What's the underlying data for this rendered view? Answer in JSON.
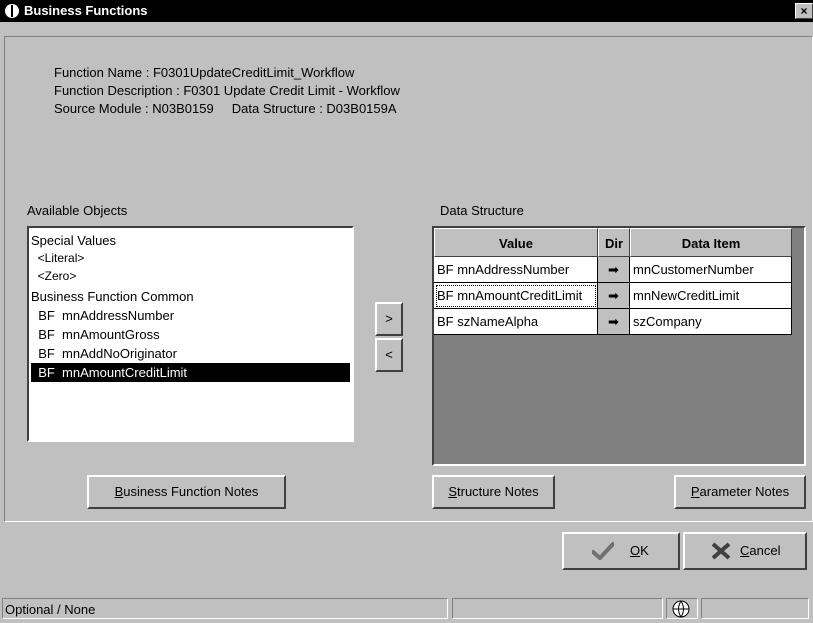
{
  "window": {
    "title": "Business Functions",
    "close_glyph": "×"
  },
  "info": {
    "function_name": "Function Name : F0301UpdateCreditLimit_Workflow",
    "function_description": "Function Description : F0301 Update Credit Limit - Workflow",
    "source_module": "Source Module : N03B0159     Data Structure : D03B0159A"
  },
  "available_objects": {
    "label": "Available Objects",
    "items": [
      {
        "text": "Special Values",
        "selected": false
      },
      {
        "text": "  <Literal>",
        "selected": false
      },
      {
        "text": "  <Zero>",
        "selected": false
      },
      {
        "text": "Business Function Common",
        "selected": false
      },
      {
        "text": "  BF  mnAddressNumber",
        "selected": false
      },
      {
        "text": "  BF  mnAmountGross",
        "selected": false
      },
      {
        "text": "  BF  mnAddNoOriginator",
        "selected": false
      },
      {
        "text": "  BF  mnAmountCreditLimit",
        "selected": true
      }
    ]
  },
  "transfer": {
    "add_label": ">",
    "remove_label": "<"
  },
  "data_structure": {
    "label": "Data Structure",
    "columns": [
      "Value",
      "Dir",
      "Data Item"
    ],
    "rows": [
      {
        "value": "BF mnAddressNumber",
        "dir": "➡",
        "data_item": "mnCustomerNumber"
      },
      {
        "value": "BF mnAmountCreditLimit",
        "dir": "➡",
        "data_item": "mnNewCreditLimit"
      },
      {
        "value": "BF szNameAlpha",
        "dir": "➡",
        "data_item": "szCompany"
      }
    ]
  },
  "buttons": {
    "bf_notes_accel": "B",
    "bf_notes_rest": "usiness Function Notes",
    "structure_notes_accel": "S",
    "structure_notes_rest": "tructure Notes",
    "parameter_notes_accel": "P",
    "parameter_notes_rest": "arameter Notes",
    "ok_accel": "O",
    "ok_rest": "K",
    "cancel_accel": "C",
    "cancel_rest": "ancel"
  },
  "status": {
    "text": "Optional / None"
  },
  "colors": {
    "face": "#c0c0c0",
    "titlebar": "#000000",
    "selection": "#000000",
    "ok_check": "#707070"
  }
}
